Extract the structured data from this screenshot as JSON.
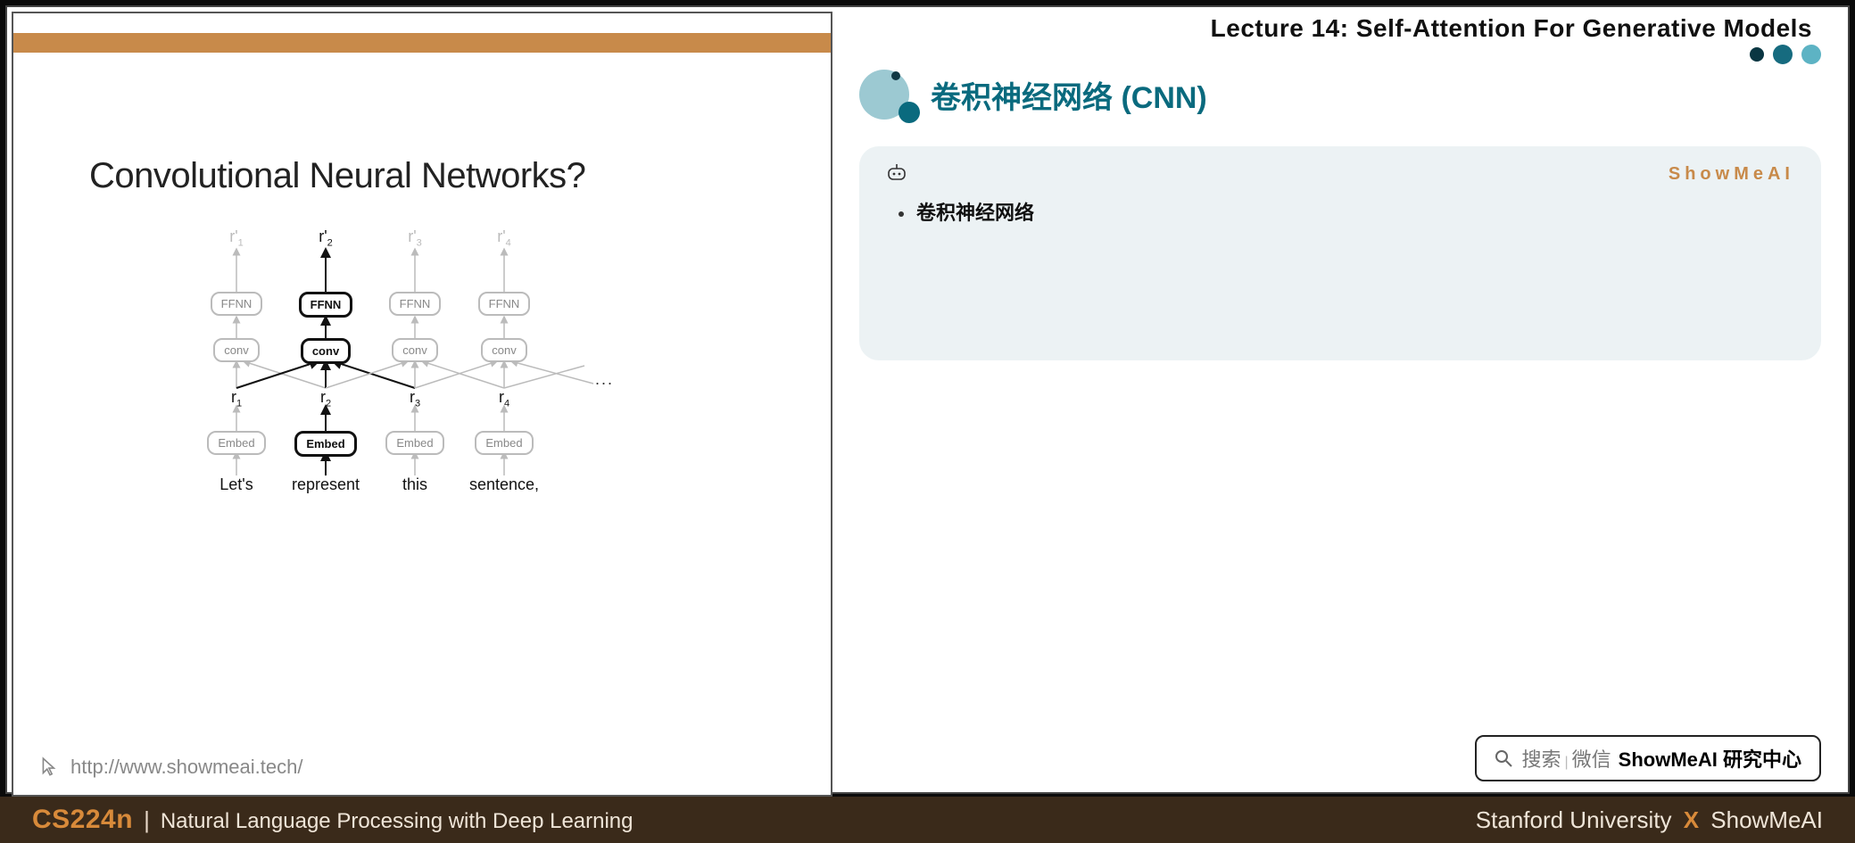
{
  "lecture_title": "Lecture 14:  Self-Attention For Generative Models",
  "section_title": "卷积神经网络 (CNN)",
  "card": {
    "brand": "ShowMeAI",
    "bullet1": "卷积神经网络"
  },
  "slide": {
    "title": "Convolutional Neural Networks?",
    "url": "http://www.showmeai.tech/",
    "diagram": {
      "outputs": [
        "r'1",
        "r'2",
        "r'3",
        "r'4"
      ],
      "ffnn": "FFNN",
      "conv": "conv",
      "r_labels": [
        "r1",
        "r2",
        "r3",
        "r4"
      ],
      "embed": "Embed",
      "words": [
        "Let's",
        "represent",
        "this",
        "sentence,"
      ],
      "dots": "..."
    }
  },
  "search": {
    "t1": "搜索",
    "t2": "微信",
    "t3": "ShowMeAI 研究中心"
  },
  "footer": {
    "course_code": "CS224n",
    "course_name": "Natural Language Processing with Deep Learning",
    "right_a": "Stanford University",
    "right_x": "X",
    "right_b": "ShowMeAI"
  }
}
